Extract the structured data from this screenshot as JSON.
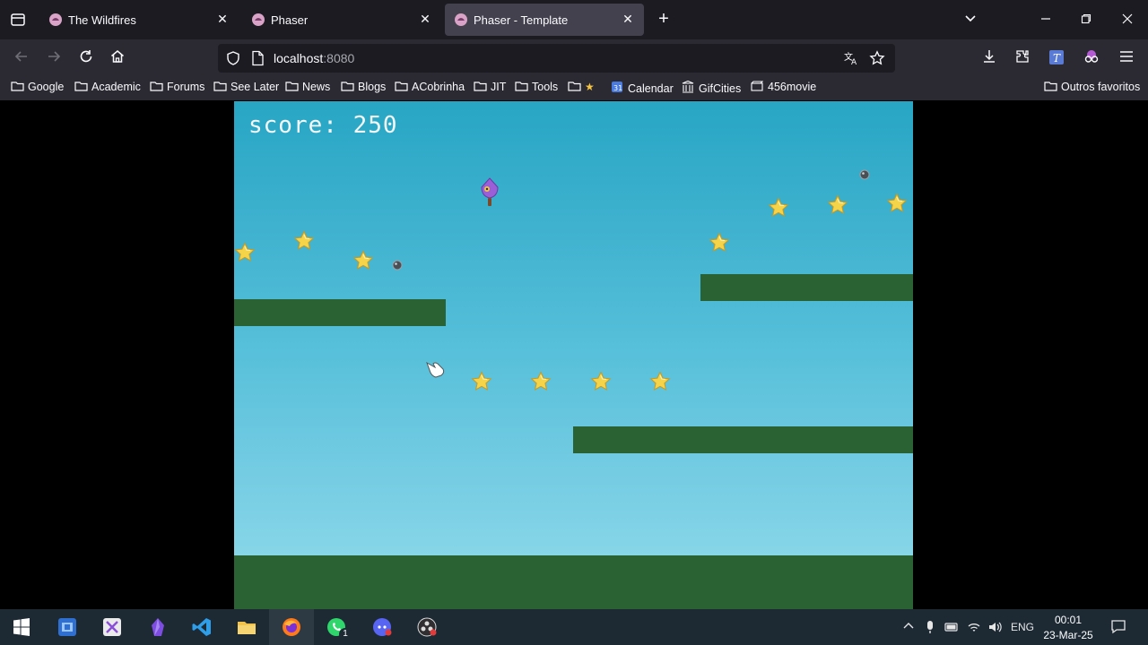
{
  "browser": {
    "tabs": [
      {
        "title": "The Wildfires",
        "active": false
      },
      {
        "title": "Phaser",
        "active": false
      },
      {
        "title": "Phaser - Template",
        "active": true
      }
    ],
    "url_host": "localhost",
    "url_port": ":8080"
  },
  "bookmarks": [
    {
      "label": "Google",
      "icon": "folder-icon"
    },
    {
      "label": "Academic",
      "icon": "folder-icon"
    },
    {
      "label": "Forums",
      "icon": "folder-icon"
    },
    {
      "label": "See Later",
      "icon": "folder-icon"
    },
    {
      "label": "News",
      "icon": "folder-icon"
    },
    {
      "label": "Blogs",
      "icon": "folder-icon"
    },
    {
      "label": "ACobrinha",
      "icon": "folder-icon"
    },
    {
      "label": "JIT",
      "icon": "folder-icon"
    },
    {
      "label": "Tools",
      "icon": "folder-icon"
    },
    {
      "label": "",
      "icon": "folder-star-icon"
    },
    {
      "label": "Calendar",
      "icon": "calendar-icon"
    },
    {
      "label": "GifCities",
      "icon": "archive-icon"
    },
    {
      "label": "456movie",
      "icon": "film-icon"
    }
  ],
  "other_bookmarks": "Outros favoritos",
  "game": {
    "score_text": "score: 250",
    "colors": {
      "platform": "#2a6233",
      "sky_top": "#27a6c4",
      "sky_bottom": "#93dceb",
      "star": "#f5d44a"
    }
  },
  "taskbar": {
    "language": "ENG",
    "time": "00:01",
    "date": "23-Mar-25",
    "whatsapp_badge": "1"
  }
}
